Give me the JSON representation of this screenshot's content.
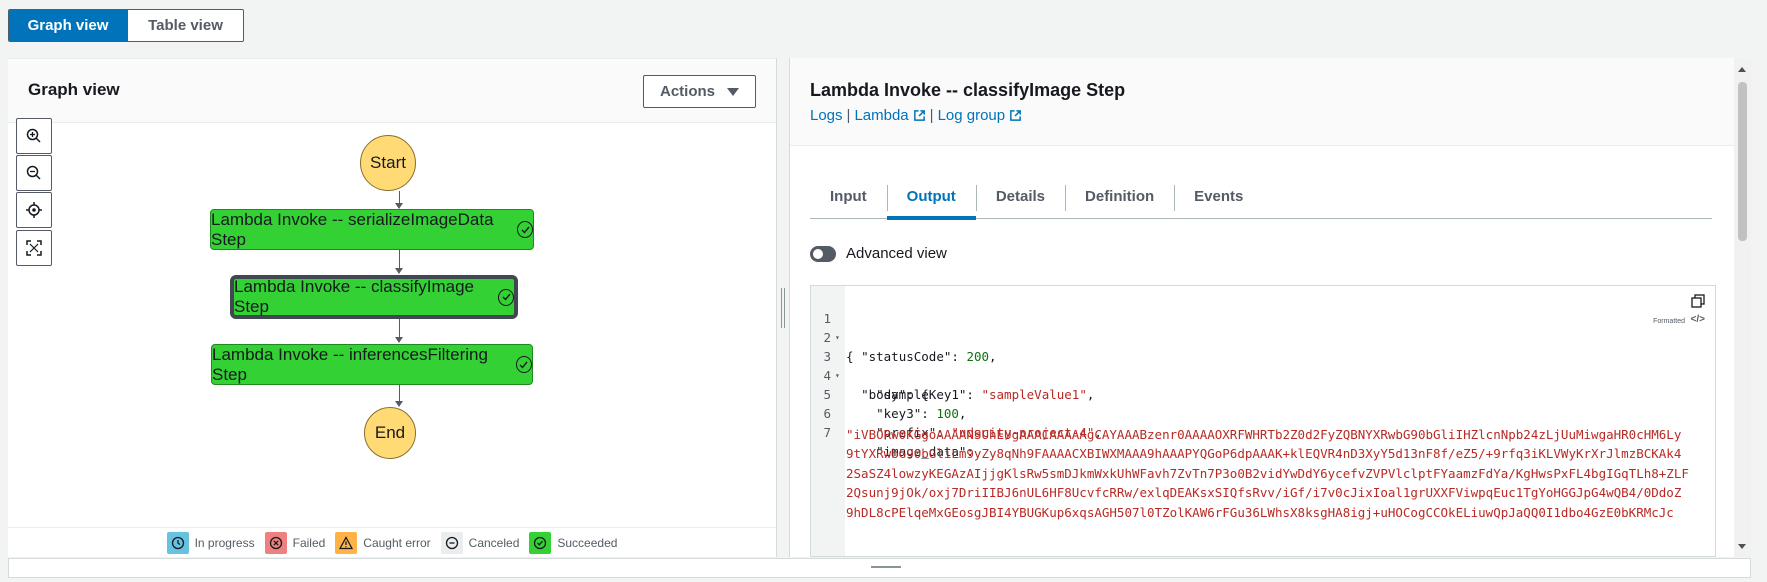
{
  "view_toggle": {
    "graph": "Graph view",
    "table": "Table view"
  },
  "graph_panel": {
    "title": "Graph view",
    "actions": "Actions",
    "nodes": {
      "start": "Start",
      "serialize": "Lambda Invoke -- serializeImageData Step",
      "classify": "Lambda Invoke -- classifyImage Step",
      "filter": "Lambda Invoke -- inferencesFiltering Step",
      "end": "End"
    },
    "legend": [
      "In progress",
      "Failed",
      "Caught error",
      "Canceled",
      "Succeeded"
    ],
    "colors": {
      "succeeded": "#34d134",
      "start_end": "#ffda75",
      "in_progress": "#66c2e0",
      "failed": "#f08080",
      "caught": "#ffb347"
    }
  },
  "details_panel": {
    "title": "Lambda Invoke -- classifyImage Step",
    "links": {
      "logs": "Logs",
      "lambda": "Lambda",
      "log_group": "Log group",
      "sep": "|"
    },
    "tabs": [
      "Input",
      "Output",
      "Details",
      "Definition",
      "Events"
    ],
    "active_tab": "Output",
    "advanced_view": "Advanced view",
    "formatted": "Formatted",
    "code": {
      "line_numbers": [
        "1",
        "2",
        "3",
        "4",
        "5",
        "6",
        "7"
      ],
      "l1": "{",
      "l2_key": "\"statusCode\"",
      "l2_val": "200",
      "l3_key": "\"body\"",
      "l3_rest": ": {",
      "l4_key": "\"sampleKey1\"",
      "l4_val": "\"sampleValue1\"",
      "l5_key": "\"key3\"",
      "l5_val": "100",
      "l6_key": "\"prefix\"",
      "l6_val": "\"udacity-project-4\"",
      "l7_key": "\"image_data\"",
      "wrapped": [
        "\"iVBORw0KGgoAAAANSUhEUgAAACAAAAAgCAYAAABzenr0AAAAOXRFWHRTb2Z0d2FyZQBNYXRwbG90bGliIHZlcnNpb24zLjUuMiwgaHR0cHM6Ly",
        "9tYXRwbG90bGliLm9yZy8qNh9FAAAACXBIWXMAAA9hAAAPYQGoP6dpAAAK+klEQVR4nD3XyY5d13nF8f/eZ5/+9rfq3iKLVWyKrXrJlmzBCKAk4",
        "2SaSZ4lowzyKEGAzAIjjgKlsRw5smDJkmWxkUhWFavh7ZvTn7P3o0B2vidYwDdY6ycefvZVPVlclptFYaamzFdYa/KgHwsPxFL4bgIGqTLh8+ZLF",
        "2Qsunj9jOk/oxj7DriIIBJ6nUL6HF8UcvfcRRw/exlqDEAKsxSIQfsRvv/iGf/i7v0cJixIoal1grUXXFViwpqEuc1TgYoHGGJpG4wQB4/0DdoZ",
        "9hDL8cPElqeMxGEosgJBI4YBUGKup6xqsAGH507l0TZolKAW6rFGu36LWhsX8ksgHA8igj+uHOCogCCOkELiuwQpJaQQ0I1dbo4GzE0bKRMcJc"
      ]
    }
  }
}
